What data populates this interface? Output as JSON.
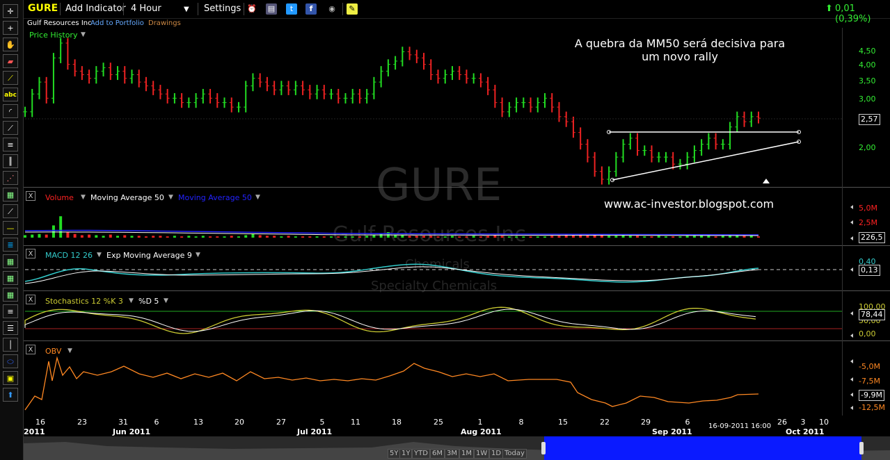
{
  "topbar": {
    "symbol": "GURE",
    "add_indicator": "Add Indicator",
    "interval": "4 Hour",
    "settings": "Settings",
    "change": "0,01 (0,39%)"
  },
  "subbar": {
    "company": "Gulf Resources Inc",
    "add_portfolio": "Add to Portfolio",
    "drawings": "Drawings"
  },
  "watermark": {
    "symbol": "GURE",
    "company": "Gulf Resources Inc",
    "sector": "Chemicals",
    "industry": "Specialty Chemicals"
  },
  "annotations": {
    "comment_line1": "A quebra da MM50 será decisiva para",
    "comment_line2": "um novo rally",
    "blog": "www.ac-investor.blogspot.com"
  },
  "colors": {
    "up": "#22dd22",
    "down": "#ee2222",
    "accent_green": "#33ee33",
    "volume_label": "#ff2222",
    "ma_blue": "#2222ff",
    "macd": "#33cccc",
    "stoch": "#cccc33",
    "obv": "#ff8822"
  },
  "chart_data": [
    {
      "type": "candlestick",
      "title": "Price History",
      "y_ticks": [
        "4,50",
        "4,00",
        "3,50",
        "3,00",
        "2,00"
      ],
      "current_value": "2,57",
      "closes": [
        2.7,
        3.1,
        3.4,
        3.0,
        4.1,
        4.6,
        3.9,
        3.7,
        3.6,
        3.5,
        3.7,
        3.8,
        3.6,
        3.7,
        3.5,
        3.6,
        3.4,
        3.3,
        3.2,
        3.1,
        3.0,
        3.0,
        2.9,
        2.9,
        3.0,
        3.1,
        3.0,
        2.9,
        2.9,
        2.8,
        2.8,
        3.3,
        3.5,
        3.4,
        3.3,
        3.2,
        3.3,
        3.2,
        3.3,
        3.2,
        3.1,
        3.2,
        3.1,
        3.1,
        3.0,
        3.0,
        3.1,
        3.0,
        3.1,
        3.4,
        3.7,
        3.9,
        4.0,
        4.3,
        4.2,
        4.1,
        3.9,
        3.6,
        3.5,
        3.6,
        3.7,
        3.6,
        3.5,
        3.5,
        3.4,
        3.2,
        2.9,
        2.7,
        2.8,
        2.9,
        2.9,
        2.8,
        2.9,
        3.0,
        2.8,
        2.6,
        2.5,
        2.3,
        2.1,
        1.9,
        1.7,
        1.6,
        1.7,
        1.9,
        2.1,
        2.2,
        2.0,
        2.0,
        1.9,
        1.9,
        1.9,
        1.8,
        1.8,
        1.9,
        2.0,
        2.1,
        2.2,
        2.1,
        2.1,
        2.4,
        2.6,
        2.5,
        2.6,
        2.57
      ]
    },
    {
      "type": "bar",
      "title": "Volume",
      "series_names": [
        "Moving Average 50",
        "Moving Average 50"
      ],
      "y_ticks": [
        "5,0M",
        "2,5M"
      ],
      "current_value": "226,5",
      "values_m": [
        0.4,
        0.5,
        0.6,
        0.5,
        2.0,
        3.5,
        0.9,
        0.6,
        0.4,
        0.5,
        0.4,
        0.3,
        0.5,
        0.3,
        0.4,
        0.3,
        0.3,
        0.2,
        0.3,
        0.3,
        0.2,
        0.3,
        0.2,
        0.3,
        0.2,
        0.3,
        0.2,
        0.2,
        0.2,
        0.3,
        0.2,
        0.4,
        0.6,
        0.4,
        0.3,
        0.3,
        0.2,
        0.3,
        0.2,
        0.2,
        0.2,
        0.2,
        0.2,
        0.2,
        0.2,
        0.2,
        0.2,
        0.2,
        0.3,
        0.4,
        0.6,
        0.9,
        0.5,
        0.4,
        0.3,
        0.3,
        0.3,
        0.3,
        0.2,
        0.2,
        0.3,
        0.2,
        0.2,
        0.3,
        0.2,
        0.3,
        0.4,
        0.3,
        0.2,
        0.2,
        0.2,
        0.2,
        0.2,
        0.2,
        0.3,
        0.3,
        0.5,
        0.4,
        0.5,
        0.4,
        0.6,
        0.5,
        0.3,
        0.3,
        0.4,
        0.3,
        0.3,
        0.2,
        0.2,
        0.3,
        0.2,
        0.2,
        0.2,
        0.3,
        0.3,
        0.4,
        0.3,
        0.2,
        0.3,
        0.4,
        0.5,
        0.3,
        0.3,
        0.2
      ]
    },
    {
      "type": "line",
      "title": "MACD 12 26",
      "signal_name": "Exp Moving Average 9",
      "y_ticks": [
        "0,40"
      ],
      "current_value": "0,13"
    },
    {
      "type": "line",
      "title": "Stochastics 12 %K 3",
      "signal_name": "%D 5",
      "y_ticks": [
        "100,00",
        "50,00",
        "0,00"
      ],
      "current_value": "78,44"
    },
    {
      "type": "line",
      "title": "OBV",
      "y_ticks": [
        "-5,0M",
        "-7,5M",
        "-12,5M"
      ],
      "current_value": "-9,9M"
    }
  ],
  "x_axis": {
    "days": [
      "16",
      "23",
      "31",
      "6",
      "13",
      "20",
      "27",
      "5",
      "11",
      "18",
      "25",
      "1",
      "8",
      "15",
      "22",
      "29",
      "6",
      "26",
      "3",
      "10"
    ],
    "months": [
      "2011",
      "Jun 2011",
      "Jul 2011",
      "Aug 2011",
      "Sep 2011",
      "Oct 2011"
    ],
    "cursor_time": "16-09-2011 16:00"
  },
  "range_buttons": [
    "5Y",
    "1Y",
    "YTD",
    "6M",
    "3M",
    "1M",
    "1W",
    "1D",
    "Today"
  ]
}
